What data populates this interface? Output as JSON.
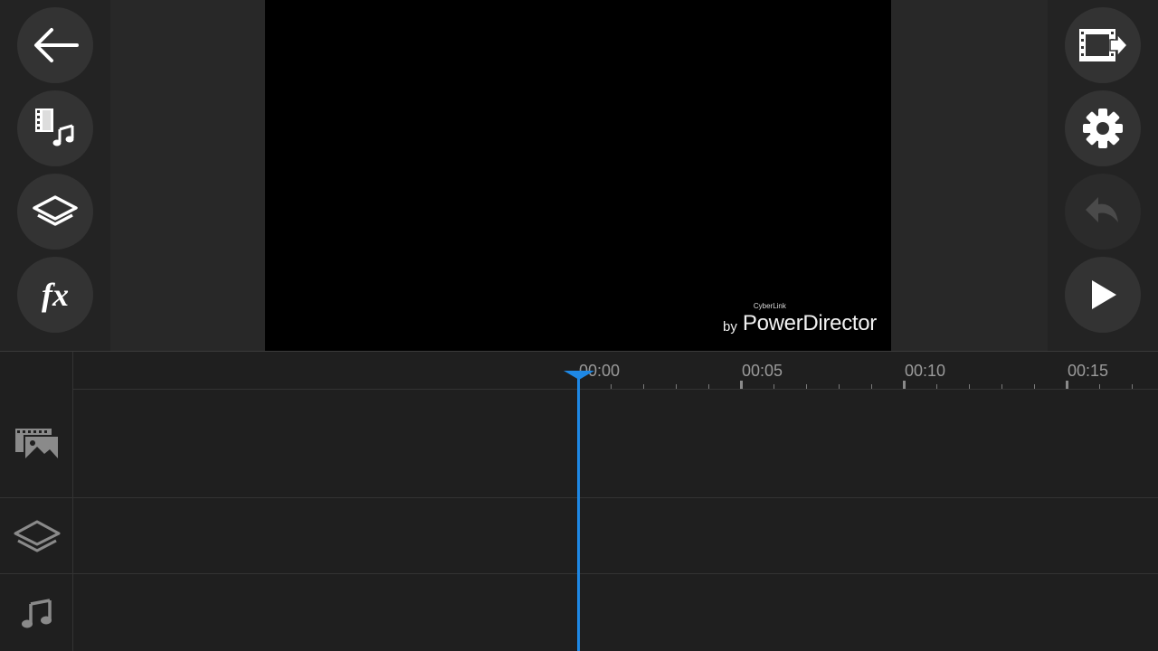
{
  "toolbar_left": {
    "back": {
      "icon": "arrow-left-icon"
    },
    "media": {
      "icon": "film-music-icon"
    },
    "layers": {
      "icon": "layers-icon"
    },
    "fx": {
      "icon": "fx-icon",
      "label": "fx"
    }
  },
  "toolbar_right": {
    "export": {
      "icon": "film-export-icon"
    },
    "settings": {
      "icon": "gear-icon"
    },
    "undo": {
      "icon": "undo-icon",
      "enabled": false
    },
    "play": {
      "icon": "play-icon"
    }
  },
  "preview": {
    "watermark": {
      "by": "by",
      "brand": "CyberLink",
      "product": "PowerDirector"
    }
  },
  "timeline": {
    "ruler": {
      "labels": [
        "00:00",
        "00:05",
        "00:10",
        "00:15"
      ]
    },
    "tracks": [
      {
        "name": "video-image-track",
        "icon": "film-image-icon"
      },
      {
        "name": "overlay-track",
        "icon": "layers-icon"
      },
      {
        "name": "audio-track",
        "icon": "music-note-icon"
      }
    ],
    "playhead_time": "00:00"
  },
  "colors": {
    "accent": "#1e88e5",
    "background": "#1f1f1f",
    "button": "#333333"
  }
}
